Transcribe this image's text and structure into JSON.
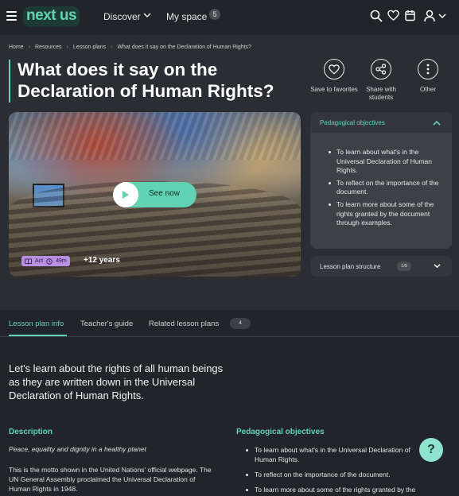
{
  "header": {
    "logo": "next us",
    "nav_discover": "Discover",
    "nav_myspace": "My space",
    "myspace_count": "5"
  },
  "breadcrumb": [
    "Home",
    "Resources",
    "Lesson plans",
    "What does it say on the Declaration of Human Rights?"
  ],
  "title": "What does it say on the Declaration of Human Rights?",
  "actions": {
    "save": "Save to favorites",
    "share": "Share with students",
    "other": "Other"
  },
  "hero": {
    "play_label": "See now",
    "tag_type": "Act",
    "tag_duration": "49m",
    "age": "+12 years"
  },
  "side_panel": {
    "objectives_title": "Pedagogical objectives",
    "objectives": [
      "To learn about what's in the Universal Declaration of Human Rights.",
      "To reflect on the importance of the document.",
      "To learn more about some of the rights granted by the document through examples."
    ],
    "structure_title": "Lesson plan structure",
    "structure_count": "1/9"
  },
  "tabs": {
    "info": "Lesson plan info",
    "guide": "Teacher's guide",
    "related": "Related lesson plans",
    "related_count": "4"
  },
  "intro": "Let's learn about the rights of all human beings as they are written down in the Universal Declaration of Human Rights.",
  "description": {
    "title": "Description",
    "motto": "Peace, equality and dignity in a healthy planet",
    "body": "This is the motto shown in the United Nations' official webpage. The UN General Assembly proclaimed the Universal Declaration of Human Rights in 1948."
  },
  "objectives_section": {
    "title": "Pedagogical objectives",
    "items": [
      "To learn about what's in the Universal Declaration of Human Rights.",
      "To reflect on the importance of the document.",
      "To learn more about some of the rights granted by the"
    ]
  },
  "help_label": "?"
}
